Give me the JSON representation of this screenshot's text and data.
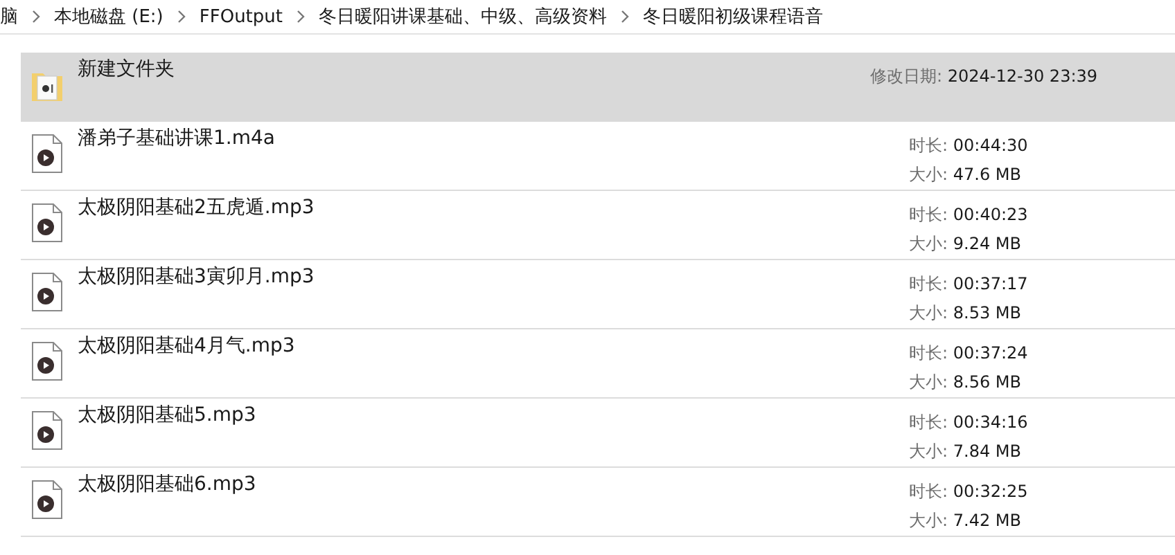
{
  "breadcrumb": [
    {
      "label": "脑"
    },
    {
      "label": "本地磁盘 (E:)"
    },
    {
      "label": "FFOutput"
    },
    {
      "label": "冬日暖阳讲课基础、中级、高级资料"
    },
    {
      "label": "冬日暖阳初级课程语音"
    }
  ],
  "items": [
    {
      "kind": "folder",
      "name": "新建文件夹",
      "selected": true,
      "details": [
        {
          "label": "修改日期:",
          "value": "2024-12-30 23:39"
        }
      ]
    },
    {
      "kind": "audio",
      "name": "潘弟子基础讲课1.m4a",
      "selected": false,
      "details": [
        {
          "label": "时长:",
          "value": "00:44:30"
        },
        {
          "label": "大小:",
          "value": "47.6 MB"
        }
      ]
    },
    {
      "kind": "audio",
      "name": "太极阴阳基础2五虎遁.mp3",
      "selected": false,
      "details": [
        {
          "label": "时长:",
          "value": "00:40:23"
        },
        {
          "label": "大小:",
          "value": "9.24 MB"
        }
      ]
    },
    {
      "kind": "audio",
      "name": "太极阴阳基础3寅卯月.mp3",
      "selected": false,
      "details": [
        {
          "label": "时长:",
          "value": "00:37:17"
        },
        {
          "label": "大小:",
          "value": "8.53 MB"
        }
      ]
    },
    {
      "kind": "audio",
      "name": "太极阴阳基础4月气.mp3",
      "selected": false,
      "details": [
        {
          "label": "时长:",
          "value": "00:37:24"
        },
        {
          "label": "大小:",
          "value": "8.56 MB"
        }
      ]
    },
    {
      "kind": "audio",
      "name": "太极阴阳基础5.mp3",
      "selected": false,
      "details": [
        {
          "label": "时长:",
          "value": "00:34:16"
        },
        {
          "label": "大小:",
          "value": "7.84 MB"
        }
      ]
    },
    {
      "kind": "audio",
      "name": "太极阴阳基础6.mp3",
      "selected": false,
      "details": [
        {
          "label": "时长:",
          "value": "00:32:25"
        },
        {
          "label": "大小:",
          "value": "7.42 MB"
        }
      ]
    }
  ]
}
